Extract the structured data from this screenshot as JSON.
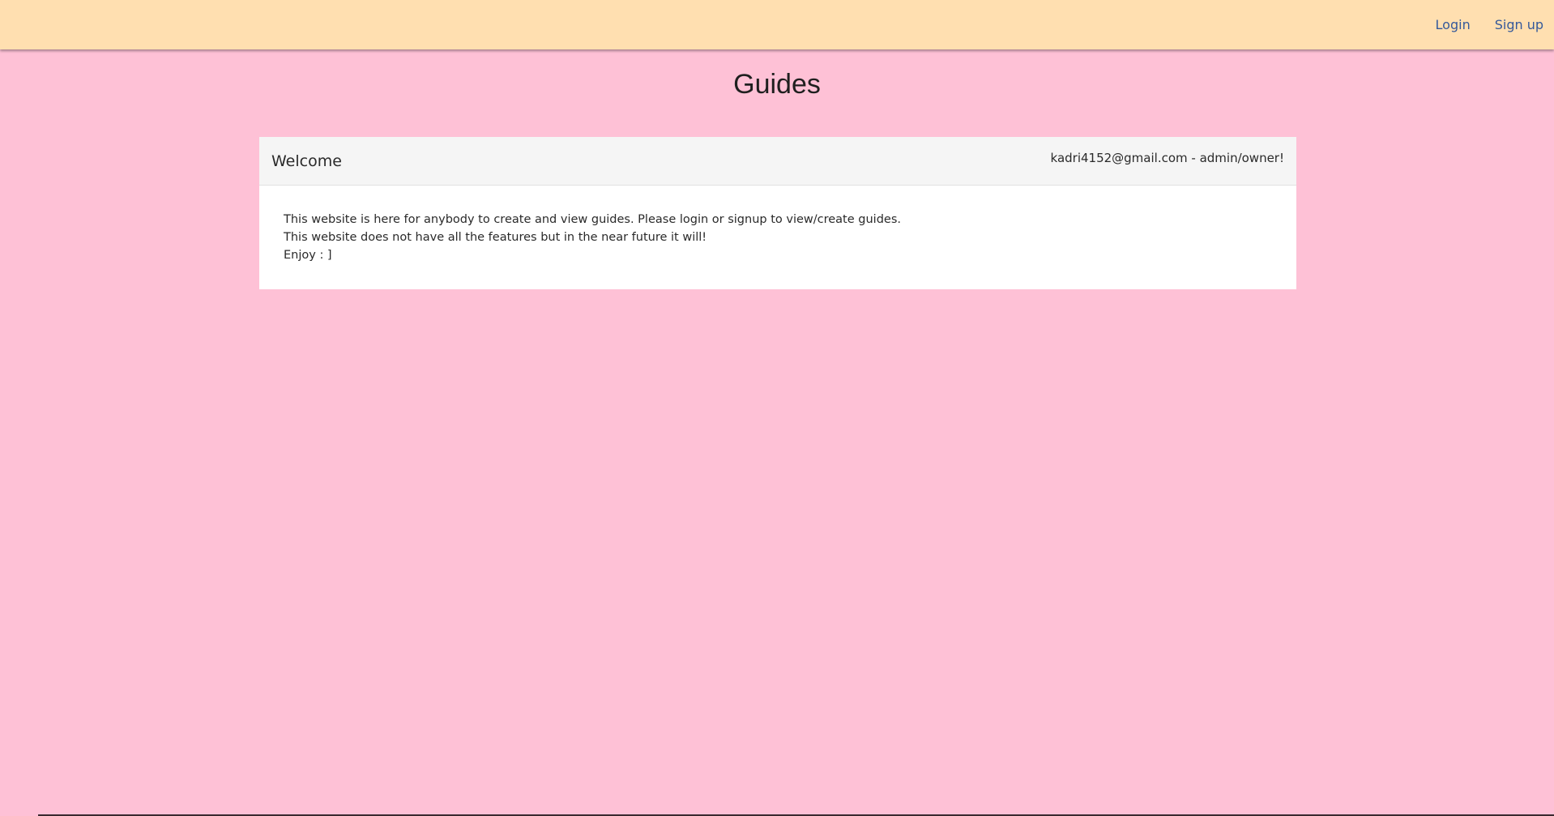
{
  "navbar": {
    "login_label": "Login",
    "signup_label": "Sign up"
  },
  "page": {
    "title": "Guides"
  },
  "card": {
    "title": "Welcome",
    "user_info": "kadri4152@gmail.com - admin/owner!",
    "lines": [
      "This website is here for anybody to create and view guides. Please login or signup to view/create guides.",
      "This website does not have all the features but in the near future it will!",
      "Enjoy : ]"
    ]
  },
  "colors": {
    "page_background": "#fec1d6",
    "navbar_background": "#ffdfb0",
    "link_color": "#35599a",
    "card_header_background": "#f5f5f5",
    "card_background": "#ffffff"
  }
}
